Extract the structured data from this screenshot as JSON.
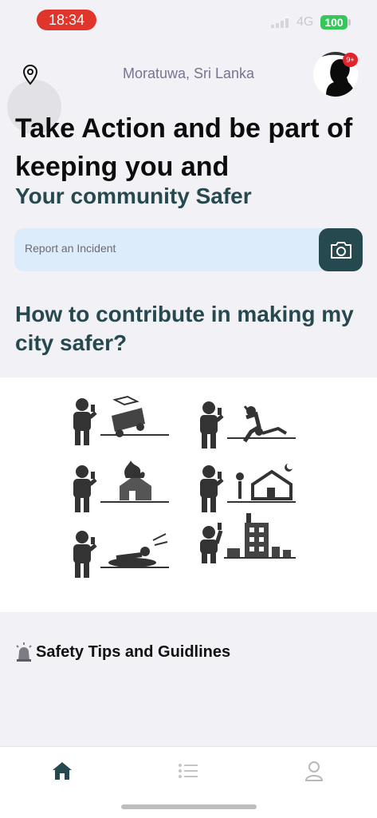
{
  "status_bar": {
    "time": "18:34",
    "network": "4G",
    "battery": "100"
  },
  "header": {
    "location": "Moratuwa, Sri Lanka",
    "notification_badge": "9+"
  },
  "hero": {
    "headline": "Take Action and be part of keeping you and",
    "subheadline": "Your community Safer"
  },
  "report": {
    "placeholder": "Report an Incident"
  },
  "contribute": {
    "title": "How to contribute in making my city safer?"
  },
  "illustrations": [
    {
      "icon": "person-reporting-car-accident-icon"
    },
    {
      "icon": "person-reporting-assault-icon"
    },
    {
      "icon": "person-reporting-house-fire-icon"
    },
    {
      "icon": "person-reporting-burglary-icon"
    },
    {
      "icon": "person-reporting-shooting-icon"
    },
    {
      "icon": "person-reporting-building-damage-icon"
    }
  ],
  "tips": {
    "label": "Safety Tips and Guidlines",
    "icon": "siren-icon"
  },
  "tabs": [
    {
      "name": "home",
      "icon": "home-icon",
      "active": true
    },
    {
      "name": "list",
      "icon": "list-icon",
      "active": false
    },
    {
      "name": "profile",
      "icon": "profile-icon",
      "active": false
    }
  ],
  "colors": {
    "accent": "#26494f",
    "report_bar": "#dcecfb",
    "time_pill": "#e0352b",
    "battery": "#34c759"
  }
}
